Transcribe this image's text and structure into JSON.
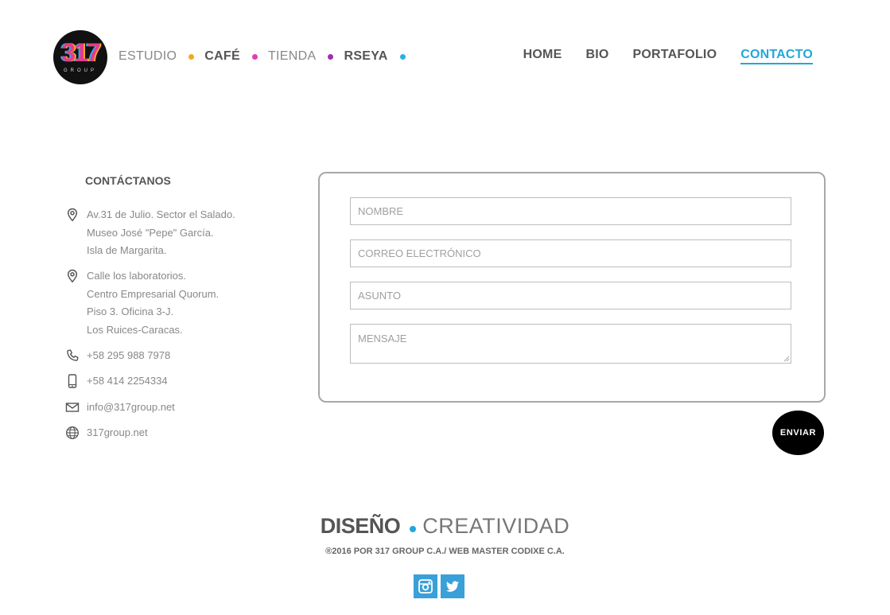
{
  "logo": {
    "number": "317",
    "sub": "GROUP"
  },
  "brands": [
    {
      "label": "ESTUDIO",
      "style": "light",
      "dot_color": "#f5a623"
    },
    {
      "label": "CAFÉ",
      "style": "bold",
      "dot_color": "#e040b0"
    },
    {
      "label": "TIENDA",
      "style": "light",
      "dot_color": "#9b2fae"
    },
    {
      "label": "RSEYA",
      "style": "bold",
      "dot_color": "#2ab0e4"
    }
  ],
  "nav": {
    "home": "HOME",
    "bio": "BIO",
    "portfolio": "PORTAFOLIO",
    "contact": "CONTACTO"
  },
  "contact": {
    "title": "CONTÁCTANOS",
    "address1": [
      "Av.31 de Julio. Sector el Salado.",
      "Museo José \"Pepe\" García.",
      "Isla de Margarita."
    ],
    "address2": [
      "Calle los laboratorios.",
      "Centro Empresarial Quorum.",
      "Piso 3. Oficina 3-J.",
      "Los Ruices-Caracas."
    ],
    "phone": "+58 295 988 7978",
    "mobile": "+58 414 2254334",
    "email": "info@317group.net",
    "web": "317group.net"
  },
  "form": {
    "name_placeholder": "NOMBRE",
    "email_placeholder": "CORREO ELECTRÓNICO",
    "subject_placeholder": "ASUNTO",
    "message_placeholder": "MENSAJE",
    "submit": "ENVIAR"
  },
  "footer": {
    "slogan_bold": "DISEÑO",
    "slogan_light": "CREATIVIDAD",
    "copyright": "®2016 POR 317 GROUP C.A./ WEB MASTER CODIXE C.A."
  },
  "colors": {
    "accent": "#22a7da",
    "social_bg": "#3aa0d8"
  }
}
